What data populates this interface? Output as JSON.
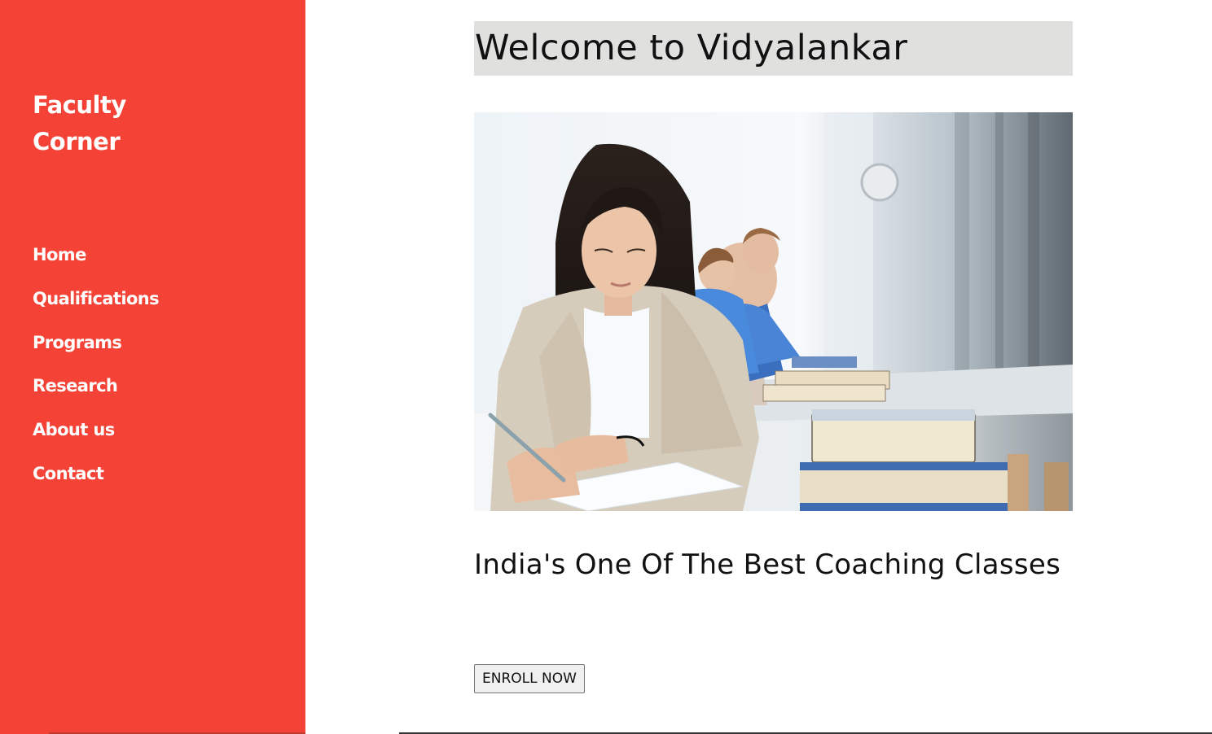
{
  "sidebar": {
    "brand_line1": "Faculty",
    "brand_line2": "Corner",
    "nav": [
      {
        "label": "Home"
      },
      {
        "label": "Qualifications"
      },
      {
        "label": "Programs"
      },
      {
        "label": "Research"
      },
      {
        "label": "About us"
      },
      {
        "label": "Contact"
      }
    ]
  },
  "main": {
    "welcome": "Welcome to Vidyalankar",
    "hero_image": "students-writing-exam-photo",
    "tagline": "India's One Of The Best Coaching Classes",
    "enroll_label": "ENROLL NOW"
  },
  "colors": {
    "sidebar_bg": "#f44336",
    "welcome_bg": "#e0e0de",
    "text": "#111111"
  }
}
